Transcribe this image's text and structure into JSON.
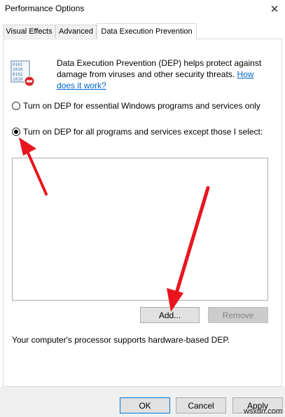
{
  "window": {
    "title": "Performance Options",
    "close_glyph": "✕"
  },
  "tabs": [
    {
      "label": "Visual Effects"
    },
    {
      "label": "Advanced"
    },
    {
      "label": "Data Execution Prevention",
      "active": true
    }
  ],
  "dep": {
    "icon": "dep-shield-binary-icon",
    "description_text": "Data Execution Prevention (DEP) helps protect against damage from viruses and other security threats.",
    "link_part1": "How",
    "link_part2": "does it work?",
    "option_essential": "Turn on DEP for essential Windows programs and services only",
    "option_all": "Turn on DEP for all programs and services except those I select:",
    "selected_option": "all",
    "add_label": "Add...",
    "remove_label": "Remove",
    "status_text": "Your computer's processor supports hardware-based DEP."
  },
  "footer": {
    "ok_label": "OK",
    "cancel_label": "Cancel",
    "apply_label": "Apply"
  },
  "watermark": "wsxdn.com",
  "colors": {
    "link": "#0066cc",
    "arrow": "#e8141e",
    "focus": "#0078d7"
  }
}
